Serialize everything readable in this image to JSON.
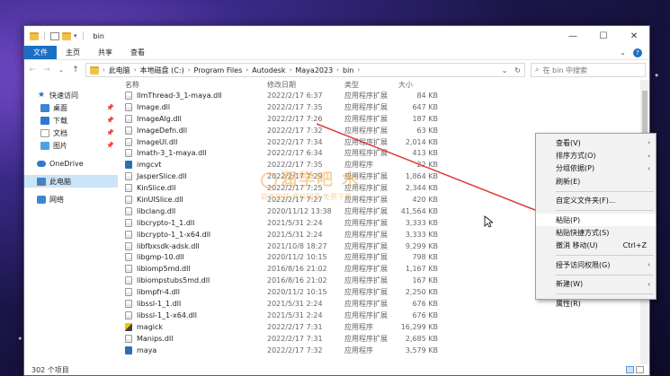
{
  "window": {
    "title": "bin",
    "ribbon_tabs": [
      "文件",
      "主页",
      "共享",
      "查看"
    ],
    "controls": {
      "minimize": "—",
      "maximize": "☐",
      "close": "✕"
    }
  },
  "address": {
    "crumbs": [
      "此电脑",
      "本地磁盘 (C:)",
      "Program Files",
      "Autodesk",
      "Maya2023",
      "bin"
    ],
    "search_placeholder": "在 bin 中搜索"
  },
  "sidebar": {
    "items": [
      {
        "label": "快速访问",
        "icon": "star-icon",
        "level": 0,
        "pinned": false
      },
      {
        "label": "桌面",
        "icon": "desktop-icon",
        "level": 1,
        "pinned": true
      },
      {
        "label": "下载",
        "icon": "download-icon",
        "level": 1,
        "pinned": true
      },
      {
        "label": "文档",
        "icon": "document-icon",
        "level": 1,
        "pinned": true
      },
      {
        "label": "图片",
        "icon": "picture-icon",
        "level": 1,
        "pinned": true
      },
      {
        "label": "OneDrive",
        "icon": "cloud-icon",
        "level": 0,
        "pinned": false
      },
      {
        "label": "此电脑",
        "icon": "computer-icon",
        "level": 0,
        "pinned": false,
        "selected": true
      },
      {
        "label": "网络",
        "icon": "network-icon",
        "level": 0,
        "pinned": false
      }
    ]
  },
  "columns": {
    "name": "名称",
    "date": "修改日期",
    "type": "类型",
    "size": "大小"
  },
  "files": [
    {
      "name": "IlmThread-3_1-maya.dll",
      "date": "2022/2/17 6:37",
      "type": "应用程序扩展",
      "size": "84 KB",
      "kind": "dll"
    },
    {
      "name": "Image.dll",
      "date": "2022/2/17 7:35",
      "type": "应用程序扩展",
      "size": "647 KB",
      "kind": "dll"
    },
    {
      "name": "ImageAlg.dll",
      "date": "2022/2/17 7:26",
      "type": "应用程序扩展",
      "size": "187 KB",
      "kind": "dll"
    },
    {
      "name": "ImageDefn.dll",
      "date": "2022/2/17 7:32",
      "type": "应用程序扩展",
      "size": "63 KB",
      "kind": "dll"
    },
    {
      "name": "ImageUI.dll",
      "date": "2022/2/17 7:34",
      "type": "应用程序扩展",
      "size": "2,014 KB",
      "kind": "dll"
    },
    {
      "name": "Imath-3_1-maya.dll",
      "date": "2022/2/17 6:34",
      "type": "应用程序扩展",
      "size": "413 KB",
      "kind": "dll"
    },
    {
      "name": "imgcvt",
      "date": "2022/2/17 7:35",
      "type": "应用程序",
      "size": "22 KB",
      "kind": "exe"
    },
    {
      "name": "JasperSlice.dll",
      "date": "2022/2/17 7:29",
      "type": "应用程序扩展",
      "size": "1,864 KB",
      "kind": "dll"
    },
    {
      "name": "KinSlice.dll",
      "date": "2022/2/17 7:25",
      "type": "应用程序扩展",
      "size": "2,344 KB",
      "kind": "dll"
    },
    {
      "name": "KinUISlice.dll",
      "date": "2022/2/17 7:27",
      "type": "应用程序扩展",
      "size": "420 KB",
      "kind": "dll"
    },
    {
      "name": "libclang.dll",
      "date": "2020/11/12 13:38",
      "type": "应用程序扩展",
      "size": "41,564 KB",
      "kind": "dll"
    },
    {
      "name": "libcrypto-1_1.dll",
      "date": "2021/5/31 2:24",
      "type": "应用程序扩展",
      "size": "3,333 KB",
      "kind": "dll"
    },
    {
      "name": "libcrypto-1_1-x64.dll",
      "date": "2021/5/31 2:24",
      "type": "应用程序扩展",
      "size": "3,333 KB",
      "kind": "dll"
    },
    {
      "name": "libfbxsdk-adsk.dll",
      "date": "2021/10/8 18:27",
      "type": "应用程序扩展",
      "size": "9,299 KB",
      "kind": "dll"
    },
    {
      "name": "libgmp-10.dll",
      "date": "2020/11/2 10:15",
      "type": "应用程序扩展",
      "size": "798 KB",
      "kind": "dll"
    },
    {
      "name": "libiomp5md.dll",
      "date": "2016/8/16 21:02",
      "type": "应用程序扩展",
      "size": "1,167 KB",
      "kind": "dll"
    },
    {
      "name": "libiompstubs5md.dll",
      "date": "2016/8/16 21:02",
      "type": "应用程序扩展",
      "size": "167 KB",
      "kind": "dll"
    },
    {
      "name": "libmpfr-4.dll",
      "date": "2020/11/2 10:15",
      "type": "应用程序扩展",
      "size": "2,250 KB",
      "kind": "dll"
    },
    {
      "name": "libssl-1_1.dll",
      "date": "2021/5/31 2:24",
      "type": "应用程序扩展",
      "size": "676 KB",
      "kind": "dll"
    },
    {
      "name": "libssl-1_1-x64.dll",
      "date": "2021/5/31 2:24",
      "type": "应用程序扩展",
      "size": "676 KB",
      "kind": "dll"
    },
    {
      "name": "magick",
      "date": "2022/2/17 7:31",
      "type": "应用程序",
      "size": "16,299 KB",
      "kind": "magick"
    },
    {
      "name": "Manips.dll",
      "date": "2022/2/17 7:31",
      "type": "应用程序扩展",
      "size": "2,685 KB",
      "kind": "dll"
    },
    {
      "name": "maya",
      "date": "2022/2/17 7:32",
      "type": "应用程序",
      "size": "3,579 KB",
      "kind": "exe"
    }
  ],
  "status": {
    "count": "302 个项目"
  },
  "context_menu": {
    "groups": [
      [
        {
          "label": "查看(V)",
          "submenu": true
        },
        {
          "label": "排序方式(O)",
          "submenu": true
        },
        {
          "label": "分组依据(P)",
          "submenu": true
        },
        {
          "label": "刷新(E)",
          "submenu": false
        }
      ],
      [
        {
          "label": "自定义文件夹(F)...",
          "submenu": false
        }
      ],
      [
        {
          "label": "粘贴(P)",
          "submenu": false,
          "highlighted": true
        },
        {
          "label": "粘贴快捷方式(S)",
          "submenu": false
        },
        {
          "label": "撤消 移动(U)",
          "submenu": false,
          "shortcut": "Ctrl+Z"
        }
      ],
      [
        {
          "label": "授予访问权限(G)",
          "submenu": true
        }
      ],
      [
        {
          "label": "新建(W)",
          "submenu": true
        }
      ],
      [
        {
          "label": "属性(R)",
          "submenu": false
        }
      ]
    ]
  },
  "watermark": {
    "main": "润学吧 木",
    "sub": "软件安装 资料网盘 免费下载"
  },
  "colors": {
    "accent": "#1a6fc4",
    "selection": "#cce4f7",
    "arrow": "#e23b3b"
  }
}
